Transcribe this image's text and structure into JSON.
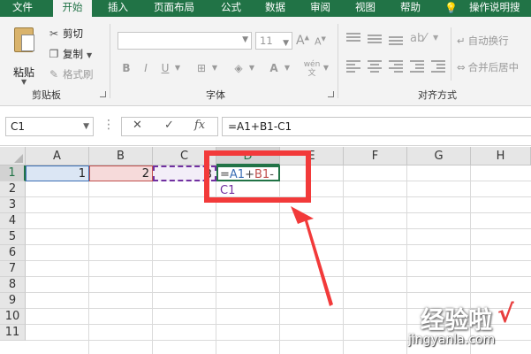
{
  "ribbon": {
    "tabs": [
      "文件",
      "开始",
      "插入",
      "页面布局",
      "公式",
      "数据",
      "审阅",
      "视图",
      "帮助"
    ],
    "active_tab": "开始",
    "tell_me": "操作说明搜索",
    "clipboard": {
      "paste_label": "粘贴",
      "cut_label": "剪切",
      "copy_label": "复制",
      "format_painter_label": "格式刷",
      "group_label": "剪贴板"
    },
    "font": {
      "name_value": "",
      "size_value": "11",
      "grow_symbol": "A",
      "bold": "B",
      "italic": "I",
      "underline": "U",
      "phonetic": "wén",
      "group_label": "字体"
    },
    "alignment": {
      "wrap_text_label": "自动换行",
      "merge_label": "合并后居中",
      "group_label": "对齐方式"
    }
  },
  "formula_bar": {
    "name_box": "C1",
    "cancel_symbol": "✕",
    "enter_symbol": "✓",
    "function_symbol": "fx",
    "formula": "=A1+B1-C1"
  },
  "grid": {
    "columns": [
      "A",
      "B",
      "C",
      "D",
      "E",
      "F",
      "G",
      "H"
    ],
    "rows": [
      "1",
      "2",
      "3",
      "4",
      "5",
      "6",
      "7",
      "8",
      "9",
      "10",
      "11"
    ],
    "cells": {
      "A1": "1",
      "B1": "2",
      "C1": "3",
      "D1_parts": [
        "=",
        "A1",
        "+",
        "B1",
        "-",
        "C1"
      ]
    }
  },
  "colors": {
    "excel_green": "#217346",
    "ref_a": "#3c6fb4",
    "ref_b": "#c0504d",
    "ref_c": "#7030a0",
    "annotation_red": "#f23a3a"
  },
  "watermark": {
    "main": "经验啦",
    "check": "√",
    "url": "jingyanla.com"
  }
}
